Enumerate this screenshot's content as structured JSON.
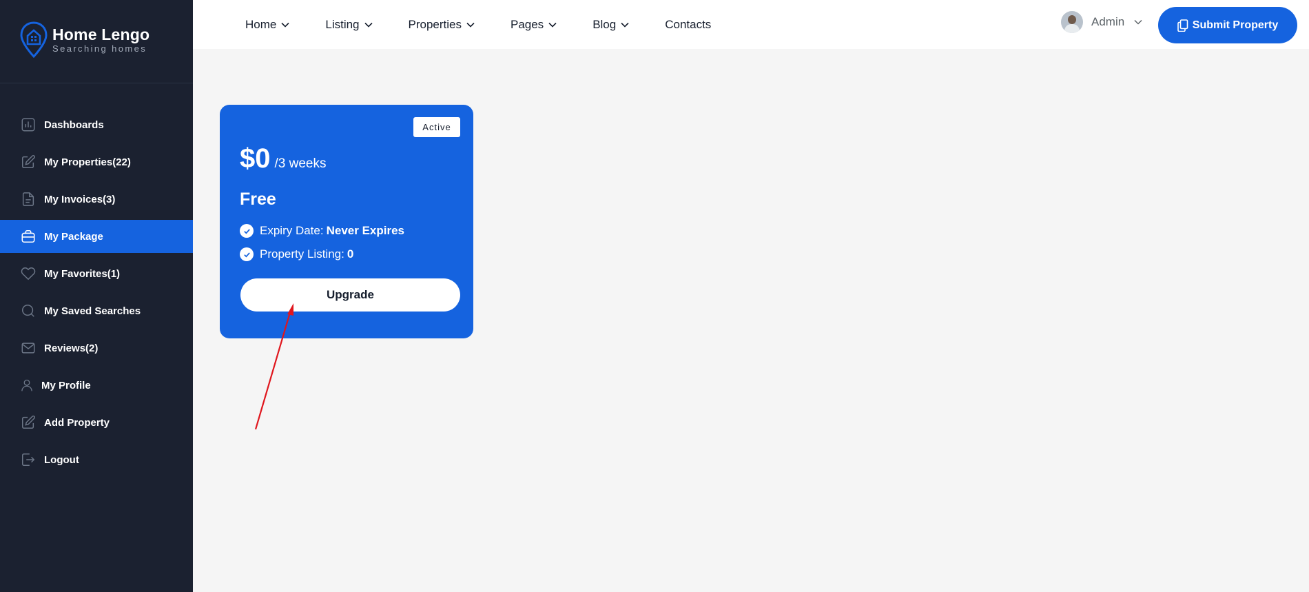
{
  "brand": {
    "title": "Home Lengo",
    "subtitle": "Searching homes"
  },
  "sidebar": {
    "items": [
      {
        "label": "Dashboards",
        "icon": "chart-bars-icon"
      },
      {
        "label": "My Properties(22)",
        "icon": "edit-icon"
      },
      {
        "label": "My Invoices(3)",
        "icon": "document-icon"
      },
      {
        "label": "My Package",
        "icon": "briefcase-icon",
        "active": true
      },
      {
        "label": "My Favorites(1)",
        "icon": "heart-icon"
      },
      {
        "label": "My Saved Searches",
        "icon": "search-icon"
      },
      {
        "label": "Reviews(2)",
        "icon": "mail-icon"
      },
      {
        "label": "My Profile",
        "icon": "user-icon"
      },
      {
        "label": "Add Property",
        "icon": "edit-icon"
      },
      {
        "label": "Logout",
        "icon": "logout-icon"
      }
    ]
  },
  "header": {
    "nav": [
      {
        "label": "Home",
        "dropdown": true
      },
      {
        "label": "Listing",
        "dropdown": true
      },
      {
        "label": "Properties",
        "dropdown": true
      },
      {
        "label": "Pages",
        "dropdown": true
      },
      {
        "label": "Blog",
        "dropdown": true
      },
      {
        "label": "Contacts",
        "dropdown": false
      }
    ],
    "user": {
      "name": "Admin"
    },
    "submit_label": "Submit Property"
  },
  "package": {
    "status": "Active",
    "price": "$0",
    "period": "/3 weeks",
    "name": "Free",
    "expiry_label": "Expiry Date:",
    "expiry_value": "Never Expires",
    "listing_label": "Property Listing:",
    "listing_value": "0",
    "upgrade_label": "Upgrade"
  },
  "colors": {
    "accent": "#1563df",
    "sidebar": "#1b2130",
    "background": "#f5f5f5",
    "annotation": "#e0161d"
  }
}
